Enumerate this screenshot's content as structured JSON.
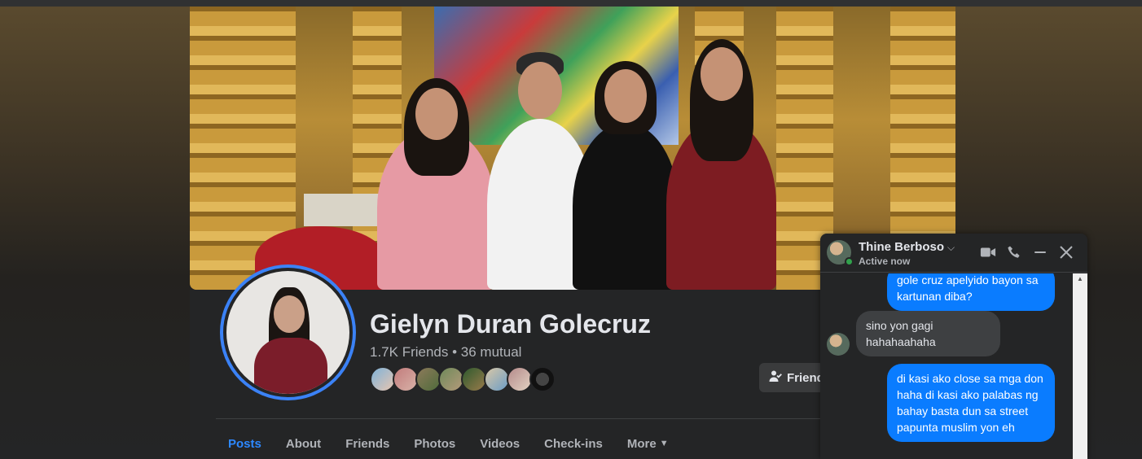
{
  "profile": {
    "name": "Gielyn Duran Golecruz",
    "friends_summary": "1.7K Friends • 36 mutual",
    "friends_button_label": "Friends"
  },
  "tabs": [
    {
      "label": "Posts",
      "active": true
    },
    {
      "label": "About"
    },
    {
      "label": "Friends"
    },
    {
      "label": "Photos"
    },
    {
      "label": "Videos"
    },
    {
      "label": "Check-ins"
    },
    {
      "label": "More"
    }
  ],
  "chat": {
    "contact_name": "Thine Berboso",
    "status": "Active now",
    "messages": [
      {
        "direction": "outgoing",
        "text": "gole cruz apelyido bayon sa kartunan diba?"
      },
      {
        "direction": "incoming",
        "text": "sino yon gagi hahahaahaha"
      },
      {
        "direction": "outgoing",
        "text": "di kasi ako close sa mga don haha di kasi ako palabas ng bahay basta dun sa street papunta muslim yon eh"
      }
    ]
  },
  "colors": {
    "accent": "#2d88ff",
    "outgoing_bubble": "#0a7cff",
    "incoming_bubble": "#3e4042",
    "online": "#31a24c",
    "avatar_ring": "#3b82f6"
  },
  "icons": [
    "user-check-icon",
    "video-call-icon",
    "phone-icon",
    "minimize-icon",
    "close-icon",
    "chevron-down-icon",
    "caret-down-icon",
    "scroll-up-arrow-icon"
  ]
}
